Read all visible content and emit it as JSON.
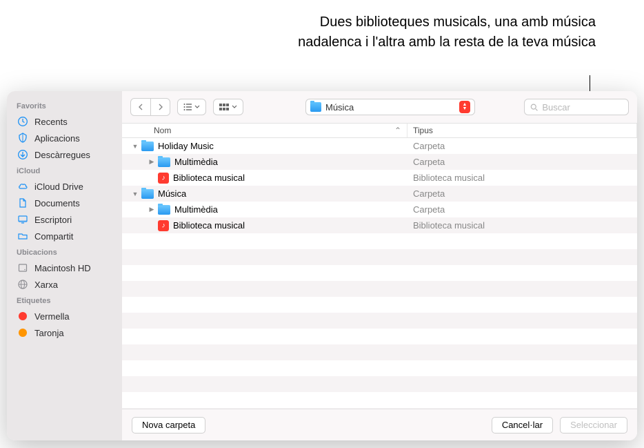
{
  "annotation": {
    "text": "Dues biblioteques musicals, una amb música nadalenca i l'altra amb la resta de la teva música"
  },
  "toolbar": {
    "path_label": "Música",
    "search_placeholder": "Buscar"
  },
  "sidebar": {
    "sections": [
      {
        "title": "Favorits",
        "items": [
          {
            "name": "recents",
            "icon": "clock-icon",
            "label": "Recents"
          },
          {
            "name": "apps",
            "icon": "apps-icon",
            "label": "Aplicacions"
          },
          {
            "name": "downloads",
            "icon": "download-icon",
            "label": "Descàrregues"
          }
        ]
      },
      {
        "title": "iCloud",
        "items": [
          {
            "name": "icloud-drive",
            "icon": "cloud-icon",
            "label": "iCloud Drive"
          },
          {
            "name": "documents",
            "icon": "document-icon",
            "label": "Documents"
          },
          {
            "name": "desktop",
            "icon": "desktop-icon",
            "label": "Escriptori"
          },
          {
            "name": "shared",
            "icon": "shared-icon",
            "label": "Compartit"
          }
        ]
      },
      {
        "title": "Ubicacions",
        "items": [
          {
            "name": "mac-hd",
            "icon": "disk-icon",
            "label": "Macintosh HD"
          },
          {
            "name": "network",
            "icon": "network-icon",
            "label": "Xarxa"
          }
        ]
      },
      {
        "title": "Etiquetes",
        "items": [
          {
            "name": "tag-red",
            "icon": "tag-dot",
            "color": "#ff3b30",
            "label": "Vermella"
          },
          {
            "name": "tag-orange",
            "icon": "tag-dot",
            "color": "#ff9500",
            "label": "Taronja"
          }
        ]
      }
    ]
  },
  "table": {
    "columns": {
      "name": "Nom",
      "type": "Tipus"
    },
    "rows": [
      {
        "indent": 0,
        "disclosure": "down",
        "icon": "folder",
        "name": "Holiday Music",
        "type": "Carpeta"
      },
      {
        "indent": 1,
        "disclosure": "right",
        "icon": "folder",
        "name": "Multimèdia",
        "type": "Carpeta"
      },
      {
        "indent": 1,
        "disclosure": "",
        "icon": "lib",
        "name": "Biblioteca musical",
        "type": "Biblioteca musical"
      },
      {
        "indent": 0,
        "disclosure": "down",
        "icon": "folder",
        "name": "Música",
        "type": "Carpeta"
      },
      {
        "indent": 1,
        "disclosure": "right",
        "icon": "folder",
        "name": "Multimèdia",
        "type": "Carpeta"
      },
      {
        "indent": 1,
        "disclosure": "",
        "icon": "lib",
        "name": "Biblioteca musical",
        "type": "Biblioteca musical"
      }
    ]
  },
  "footer": {
    "new_folder": "Nova carpeta",
    "cancel": "Cancel·lar",
    "select": "Seleccionar"
  },
  "icon_colors": {
    "accent_blue": "#1c91f5",
    "red": "#ff3b30"
  }
}
